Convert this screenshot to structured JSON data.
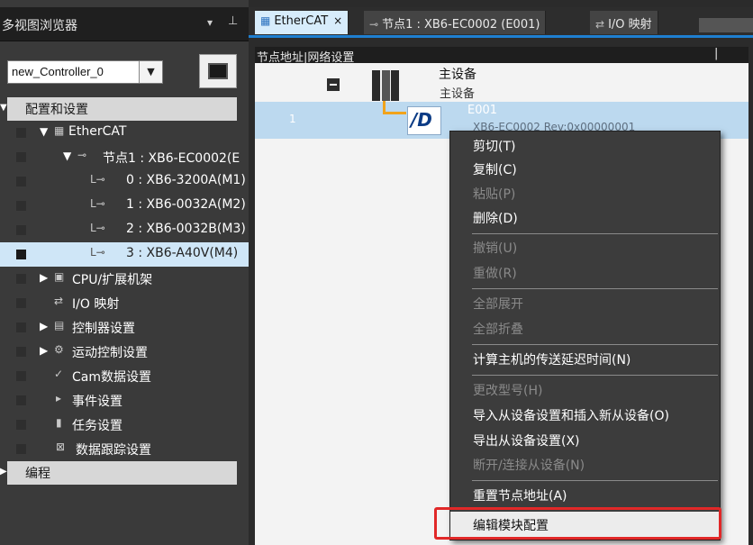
{
  "left_pane": {
    "title": "多视图浏览器",
    "pin_icon": "pin-icon",
    "collapse_icon": "collapse-icon",
    "controller_select": {
      "value": "new_Controller_0"
    },
    "config_header": "配置和设置",
    "tree": [
      {
        "label": "EtherCAT",
        "twisty": "▼",
        "icon": "ethercat-icon"
      },
      {
        "label": "节点1 : XB6-EC0002(E",
        "twisty": "▼",
        "icon": "node-icon"
      },
      {
        "label": "0 : XB6-3200A(M1)",
        "twisty": "",
        "icon": "module-icon"
      },
      {
        "label": "1 : XB6-0032A(M2)",
        "twisty": "",
        "icon": "module-icon"
      },
      {
        "label": "2 : XB6-0032B(M3)",
        "twisty": "",
        "icon": "module-icon"
      },
      {
        "label": "3 : XB6-A40V(M4)",
        "twisty": "",
        "icon": "module-icon"
      },
      {
        "label": "CPU/扩展机架",
        "twisty": "▶",
        "icon": "cpu-rack-icon"
      },
      {
        "label": "I/O 映射",
        "twisty": "",
        "icon": "io-map-icon"
      },
      {
        "label": "控制器设置",
        "twisty": "▶",
        "icon": "controller-settings-icon"
      },
      {
        "label": "运动控制设置",
        "twisty": "▶",
        "icon": "gear-icon"
      },
      {
        "label": "Cam数据设置",
        "twisty": "",
        "icon": "cam-icon"
      },
      {
        "label": "事件设置",
        "twisty": "",
        "icon": "flag-icon"
      },
      {
        "label": "任务设置",
        "twisty": "",
        "icon": "task-icon"
      },
      {
        "label": "数据跟踪设置",
        "twisty": "",
        "icon": "trace-icon"
      }
    ],
    "program_header": "编程"
  },
  "tabs": [
    {
      "label": "EtherCAT",
      "close": "×"
    },
    {
      "label": "节点1 : XB6-EC0002 (E001)"
    },
    {
      "label": "I/O 映射"
    }
  ],
  "address_bar": {
    "label": "节点地址|网络设置",
    "marker": "|"
  },
  "canvas": {
    "master_name": "主设备",
    "master_sub": "主设备",
    "node_number": "1",
    "node_id": "E001",
    "node_model": "XB6-EC0002 Rev:0x00000001",
    "node_logo_text": "/D"
  },
  "context_menu": {
    "items": [
      {
        "label": "剪切(T)",
        "enabled": true
      },
      {
        "label": "复制(C)",
        "enabled": true
      },
      {
        "label": "粘贴(P)",
        "enabled": false
      },
      {
        "label": "删除(D)",
        "enabled": true
      },
      {
        "label": "撤销(U)",
        "enabled": false
      },
      {
        "label": "重做(R)",
        "enabled": false
      },
      {
        "label": "全部展开",
        "enabled": false
      },
      {
        "label": "全部折叠",
        "enabled": false
      },
      {
        "label": "计算主机的传送延迟时间(N)",
        "enabled": true
      },
      {
        "label": "更改型号(H)",
        "enabled": false
      },
      {
        "label": "导入从设备设置和插入新从设备(O)",
        "enabled": true
      },
      {
        "label": "导出从设备设置(X)",
        "enabled": true
      },
      {
        "label": "断开/连接从设备(N)",
        "enabled": false
      },
      {
        "label": "重置节点地址(A)",
        "enabled": true
      },
      {
        "label": "编辑模块配置",
        "enabled": true
      }
    ],
    "highlight_color": "#e12828"
  }
}
